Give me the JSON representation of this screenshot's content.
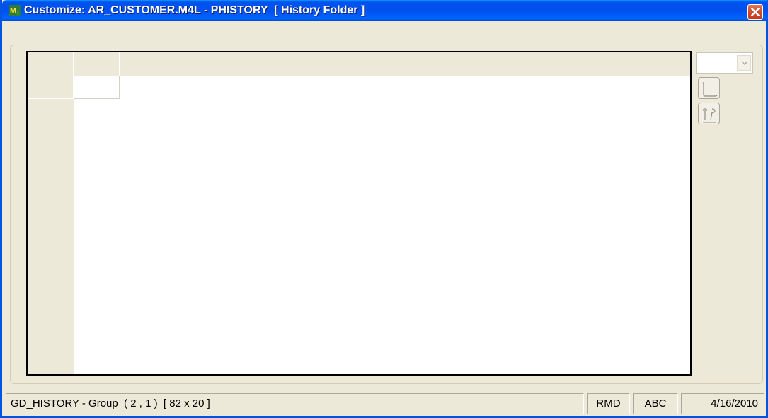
{
  "window": {
    "title": "Customize: AR_CUSTOMER.M4L - PHISTORY  [ History Folder ]",
    "app_icon": "mt-app-icon",
    "close_icon": "close-icon"
  },
  "toolbar": {
    "combo_value": "",
    "button_1_icon": "blank-page-icon",
    "button_2_icon": "tools-icon"
  },
  "statusbar": {
    "control_info": "GD_HISTORY - Group  ( 2 , 1 )  [ 82 x 20 ]",
    "mode": "RMD",
    "indicator": "ABC",
    "date": "4/16/2010"
  },
  "colors": {
    "titlebar": "#0054E3",
    "window_bg": "#ECE9D8",
    "close_button": "#D8502F"
  }
}
